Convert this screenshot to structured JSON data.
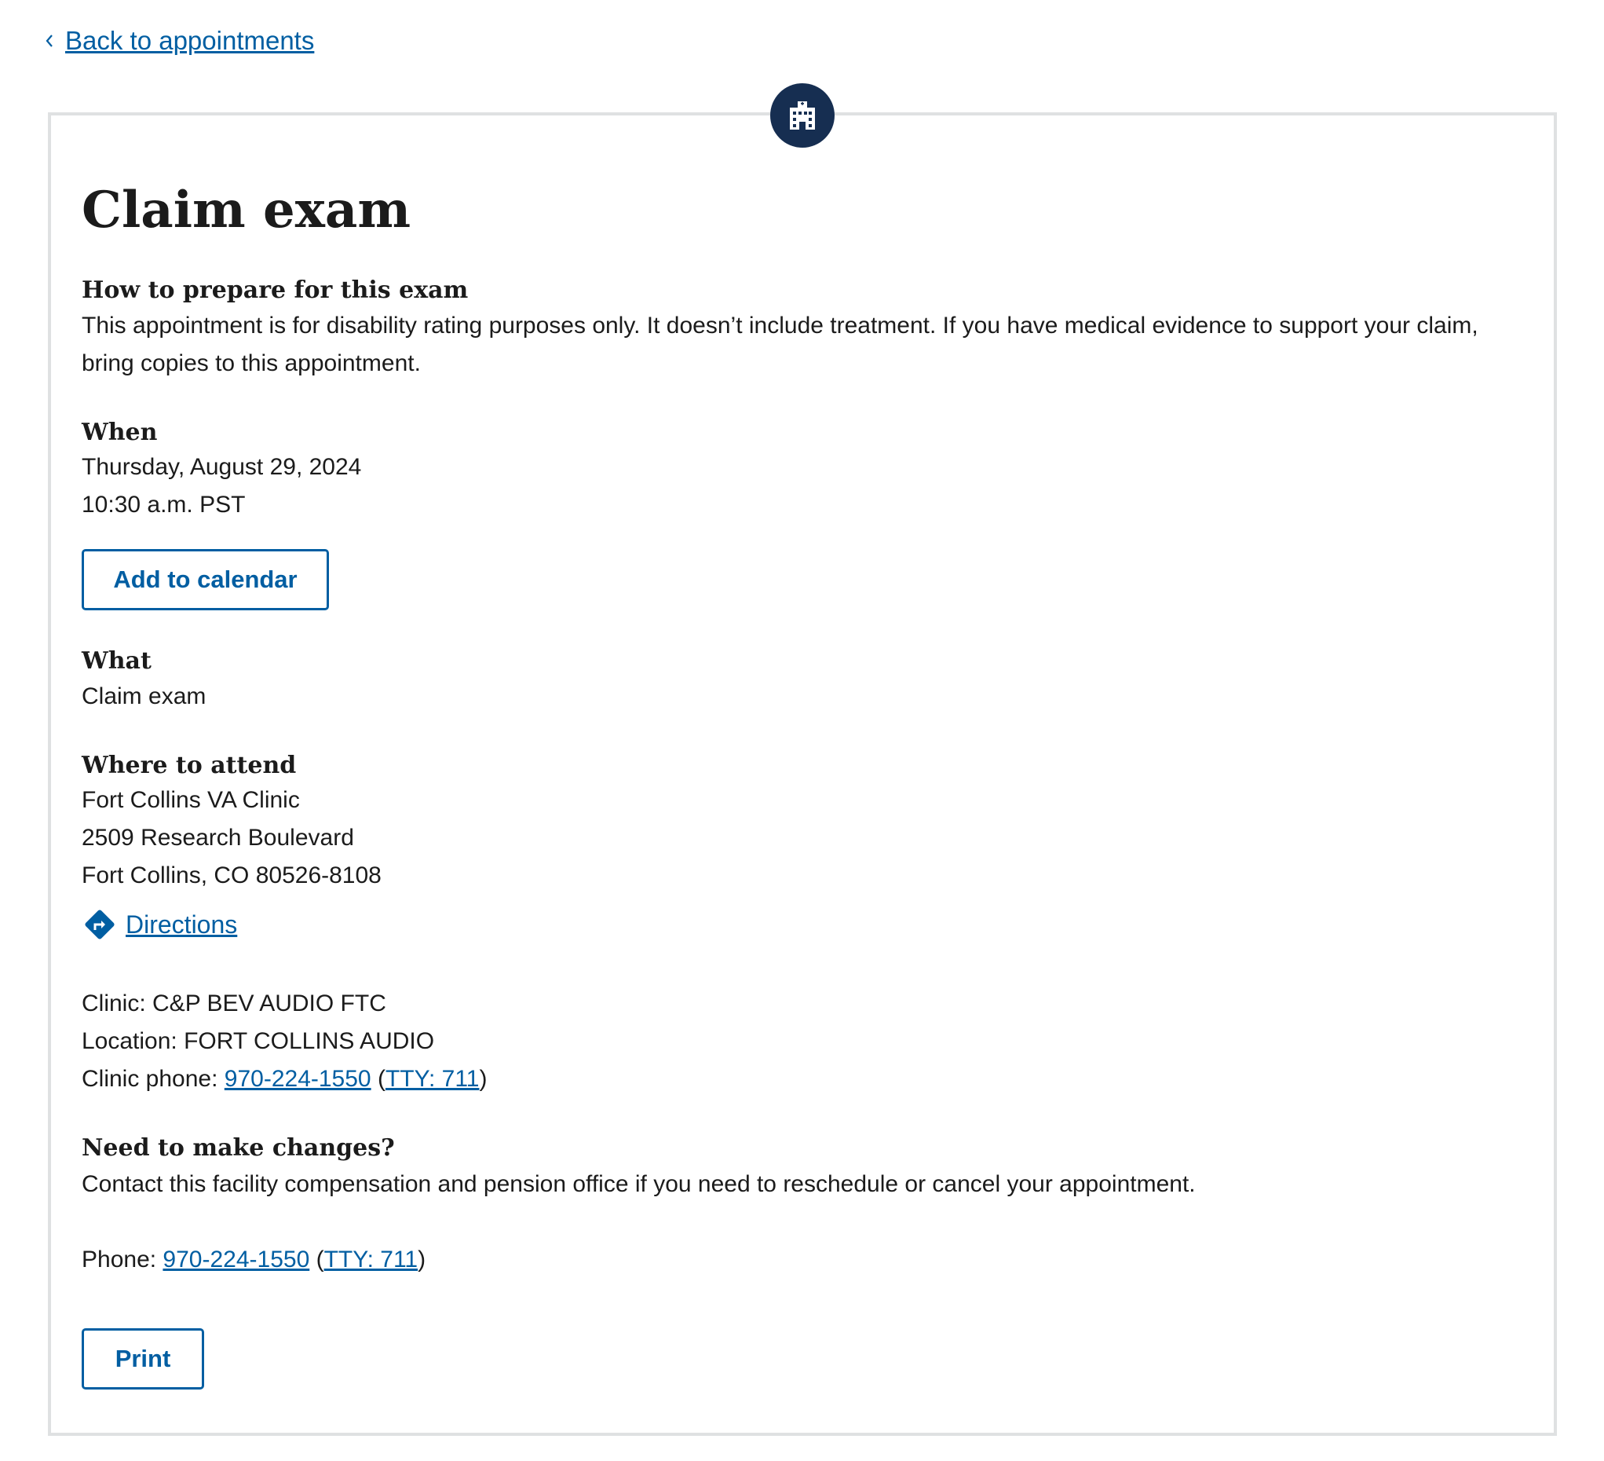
{
  "nav": {
    "back_label": "Back to appointments"
  },
  "icons": {
    "back": "chevron-left-icon",
    "badge": "building-icon",
    "directions": "directions-icon"
  },
  "colors": {
    "link": "#005ea2",
    "badge_bg": "#162e51",
    "card_border": "#dfe1e2"
  },
  "appointment": {
    "title": "Claim exam",
    "prepare": {
      "heading": "How to prepare for this exam",
      "text": "This appointment is for disability rating purposes only. It doesn’t include treatment. If you have medical evidence to support your claim, bring copies to this appointment."
    },
    "when": {
      "heading": "When",
      "date": "Thursday, August 29, 2024",
      "time": "10:30 a.m. PST",
      "calendar_button": "Add to calendar"
    },
    "what": {
      "heading": "What",
      "value": "Claim exam"
    },
    "where": {
      "heading": "Where to attend",
      "facility": "Fort Collins VA Clinic",
      "street": "2509 Research Boulevard",
      "city": "Fort Collins, CO 80526-8108",
      "directions_label": "Directions"
    },
    "clinic": {
      "clinic_line": "Clinic: C&P BEV AUDIO FTC",
      "location_line": "Location: FORT COLLINS AUDIO",
      "phone_prefix": "Clinic phone: ",
      "phone": "970-224-1550",
      "open_paren": "(",
      "tty": "TTY: 711",
      "close_paren": ")"
    },
    "changes": {
      "heading": "Need to make changes?",
      "text": "Contact this facility compensation and pension office if you need to reschedule or cancel your appointment.",
      "phone_prefix": "Phone: ",
      "phone": "970-224-1550",
      "open_paren": "(",
      "tty": "TTY: 711",
      "close_paren": ")"
    },
    "print_button": "Print"
  }
}
